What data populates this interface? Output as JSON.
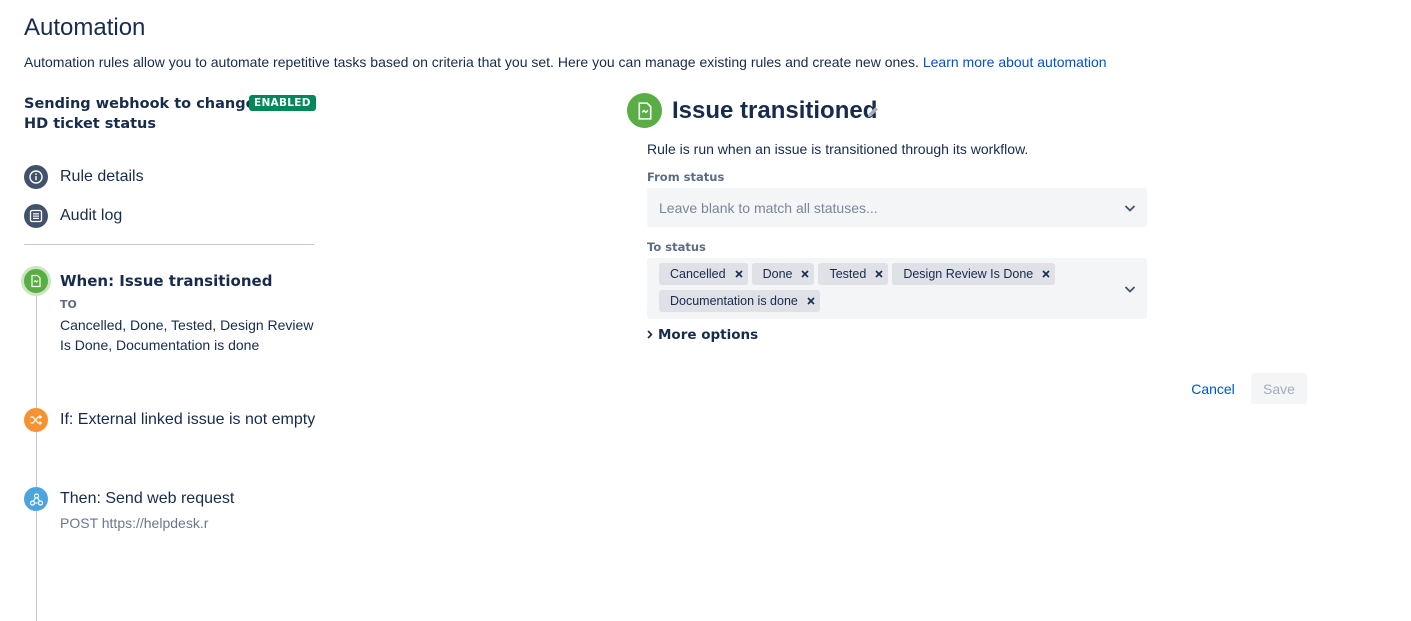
{
  "header": {
    "title": "Automation",
    "description": "Automation rules allow you to automate repetitive tasks based on criteria that you set. Here you can manage existing rules and create new ones.",
    "learn_more_link": "Learn more about automation"
  },
  "rule": {
    "name_line1": "Sending webhook to change",
    "name_line2": "HD ticket status",
    "status_badge": "ENABLED"
  },
  "nav": {
    "rule_details": "Rule details",
    "audit_log": "Audit log"
  },
  "steps": {
    "when": {
      "title": "When: Issue transitioned",
      "sub_label": "TO",
      "sub_line1": "Cancelled, Done, Tested, Design Review",
      "sub_line2": "Is Done, Documentation is done"
    },
    "if": {
      "title": "If: External linked issue is not empty"
    },
    "then": {
      "title": "Then: Send web request",
      "sub": "POST https://helpdesk.r"
    }
  },
  "trigger": {
    "title": "Issue transitioned",
    "description": "Rule is run when an issue is transitioned through its workflow.",
    "from_status": {
      "label": "From status",
      "placeholder": "Leave blank to match all statuses..."
    },
    "to_status": {
      "label": "To status",
      "values": [
        "Cancelled",
        "Done",
        "Tested",
        "Design Review Is Done",
        "Documentation is done"
      ]
    },
    "more_options": "More options"
  },
  "actions": {
    "cancel": "Cancel",
    "save": "Save"
  },
  "colors": {
    "primary_link": "#0052cc",
    "enabled_badge": "#00875a",
    "trigger_green": "#5aac44",
    "condition_orange": "#f79232",
    "action_blue": "#4ca4dc",
    "nav_icon": "#42526e"
  },
  "icons": {
    "trigger": "issue-transitioned-icon",
    "condition": "shuffle-icon",
    "action": "webhook-icon",
    "rule_details": "info-icon",
    "audit_log": "list-icon",
    "edit": "pencil-icon",
    "dropdown": "chevron-down-icon",
    "remove": "close-icon",
    "expand": "chevron-right-icon"
  }
}
